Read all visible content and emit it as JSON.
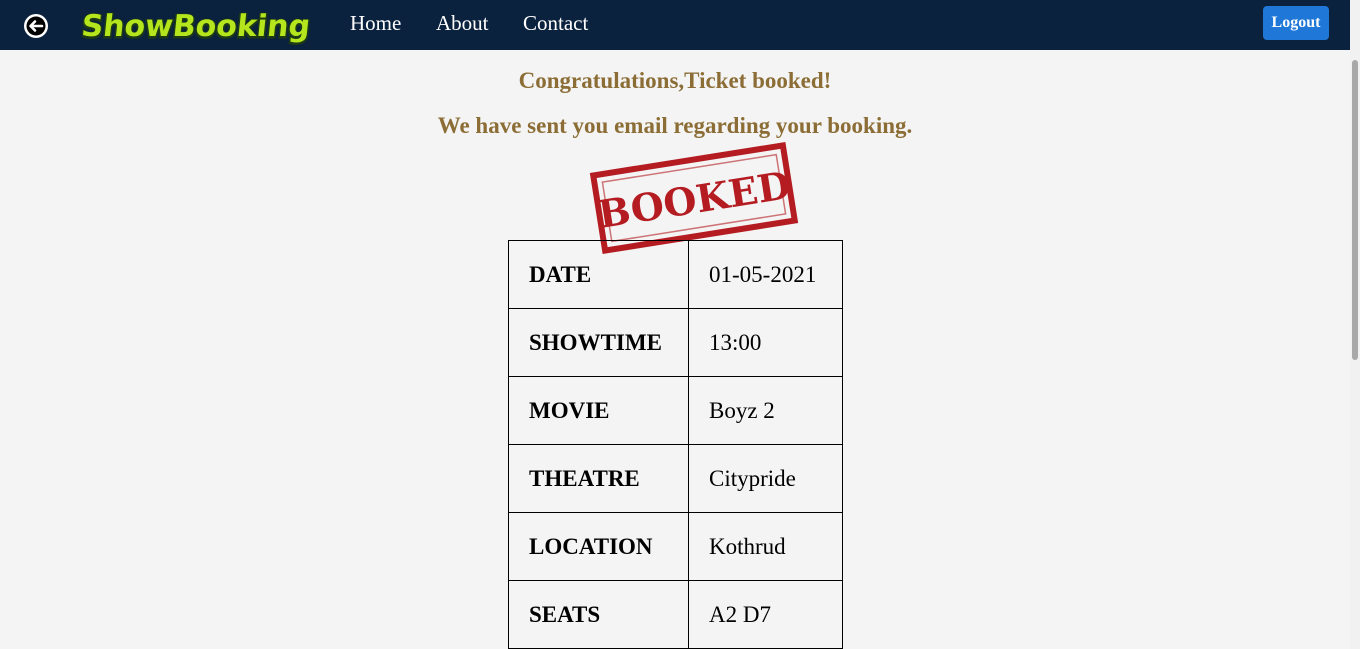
{
  "navbar": {
    "back_icon": "arrow-left-circle-icon",
    "logo_text": "ShowBooking",
    "links": [
      {
        "label": "Home"
      },
      {
        "label": "About"
      },
      {
        "label": "Contact"
      }
    ],
    "logout_label": "Logout"
  },
  "messages": {
    "congrats": "Congratulations,Ticket booked!",
    "email_note": "We have sent you email regarding your booking."
  },
  "stamp": {
    "text": "BOOKED",
    "color": "#b41c22"
  },
  "booking": {
    "rows": [
      {
        "key": "DATE",
        "value": "01-05-2021"
      },
      {
        "key": "SHOWTIME",
        "value": "13:00"
      },
      {
        "key": "MOVIE",
        "value": "Boyz 2"
      },
      {
        "key": "THEATRE",
        "value": "Citypride"
      },
      {
        "key": "LOCATION",
        "value": "Kothrud"
      },
      {
        "key": "SEATS",
        "value": "A2 D7"
      }
    ]
  },
  "colors": {
    "navbar_bg": "#0b223f",
    "logo_green": "#b5e61d",
    "message_gold": "#8b6d35",
    "button_blue": "#1f77d8"
  }
}
